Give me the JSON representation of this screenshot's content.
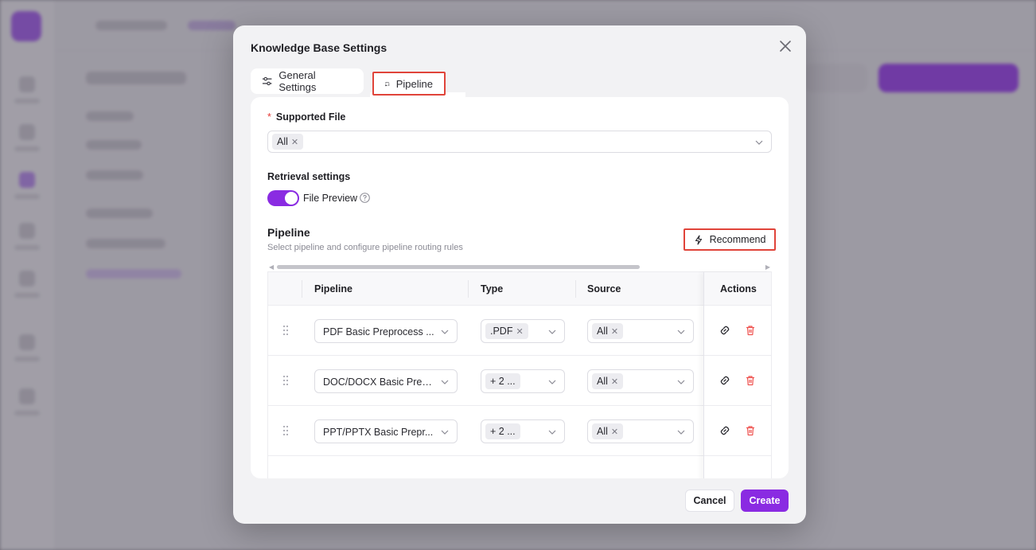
{
  "modal": {
    "title": "Knowledge Base Settings",
    "tabs": [
      {
        "label": "General Settings",
        "icon": "sliders-icon"
      },
      {
        "label": "Pipeline",
        "icon": "pipeline-icon",
        "active": true
      }
    ],
    "supported_file": {
      "label": "Supported File",
      "required": "*",
      "selected_tag": "All"
    },
    "retrieval": {
      "label": "Retrieval settings",
      "file_preview_label": "File Preview",
      "file_preview_on": true
    },
    "pipeline_section": {
      "title": "Pipeline",
      "subtitle": "Select pipeline and configure pipeline routing rules",
      "recommend_label": "Recommend"
    },
    "table": {
      "headers": {
        "pipeline": "Pipeline",
        "type": "Type",
        "source": "Source",
        "actions": "Actions"
      },
      "rows": [
        {
          "pipeline": "PDF Basic Preprocess ...",
          "type": ".PDF",
          "source": "All"
        },
        {
          "pipeline": "DOC/DOCX Basic Prepr...",
          "type": "+ 2 ...",
          "source": "All"
        },
        {
          "pipeline": "PPT/PPTX Basic Prepr...",
          "type": "+ 2 ...",
          "source": "All"
        }
      ]
    },
    "footer": {
      "cancel": "Cancel",
      "create": "Create"
    }
  },
  "colors": {
    "accent": "#8a2be2",
    "highlight": "#e0443a",
    "danger": "#ef5350"
  }
}
